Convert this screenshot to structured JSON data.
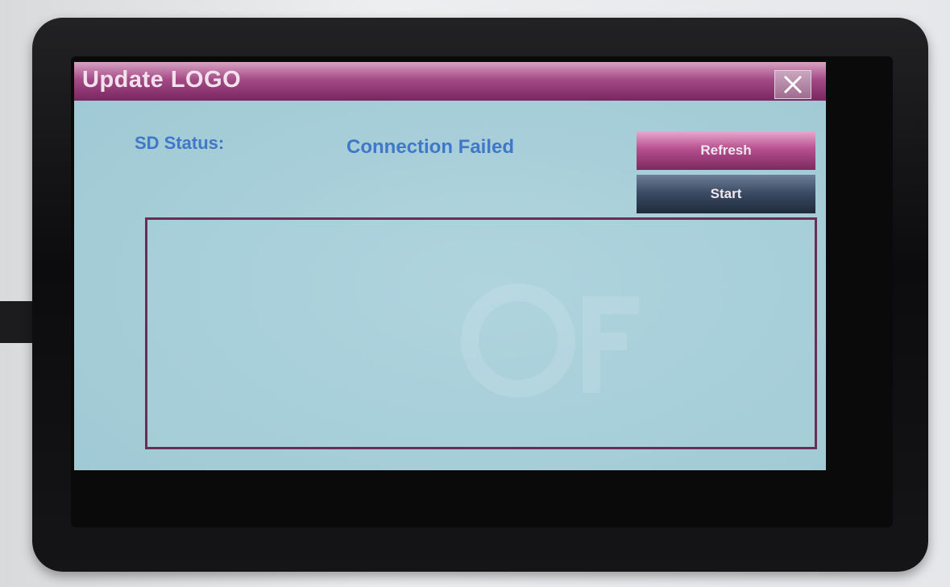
{
  "window": {
    "title": "Update LOGO",
    "close_icon": "close-icon"
  },
  "sd_status": {
    "label": "SD Status:",
    "value": "Connection Failed"
  },
  "buttons": {
    "refresh_label": "Refresh",
    "start_label": "Start"
  },
  "colors": {
    "title_bar": "#a44b86",
    "text_accent": "#3f78c8",
    "panel_border": "#6d2b58",
    "screen_bg": "#a8cfd9"
  }
}
